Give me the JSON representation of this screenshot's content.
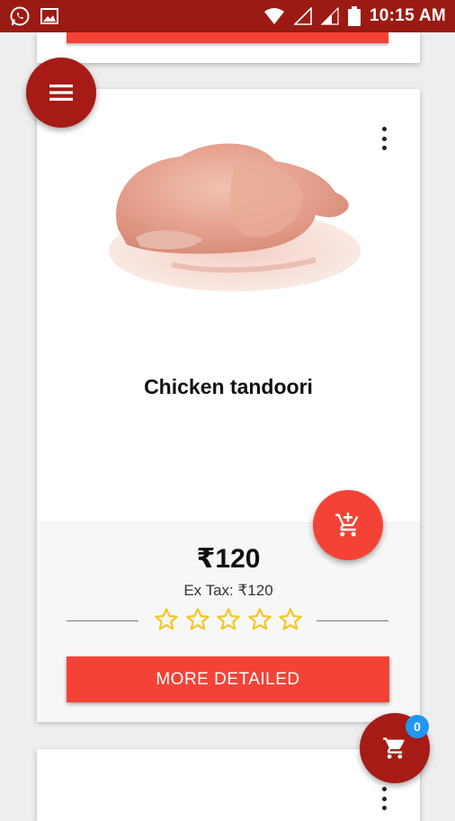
{
  "status_bar": {
    "time": "10:15 AM",
    "icons": [
      "whatsapp-icon",
      "image-icon",
      "wifi-icon",
      "signal-icon",
      "signal-icon",
      "battery-icon"
    ]
  },
  "product": {
    "name": "Chicken tandoori",
    "price": "₹120",
    "ex_tax": "Ex Tax: ₹120",
    "rating": 0,
    "rating_max": 5,
    "details_label": "MORE DETAILED"
  },
  "cart": {
    "count": "0"
  },
  "colors": {
    "status_bar": "#9b1b14",
    "accent_red": "#f44336",
    "dark_red": "#a61b15",
    "badge_blue": "#2196f3",
    "star": "#f5c518"
  }
}
